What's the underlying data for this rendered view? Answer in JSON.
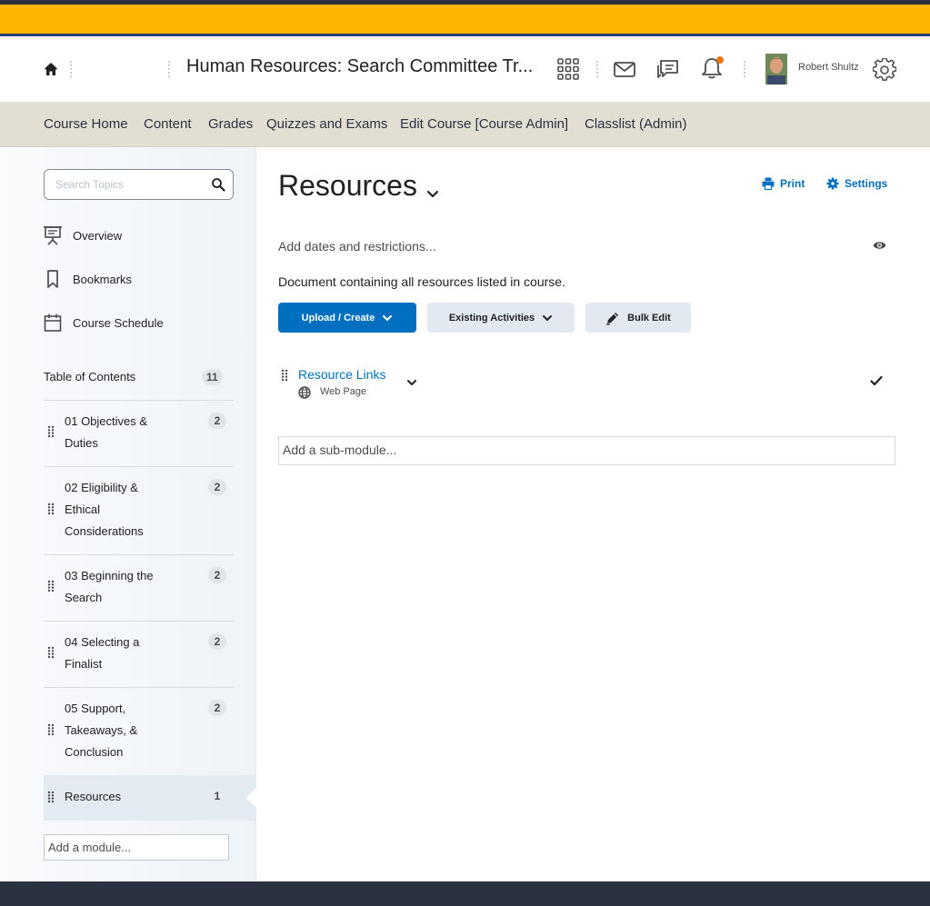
{
  "header": {
    "course_title": "Human Resources: Search Committee Tr...",
    "user_name": "Robert Shultz",
    "notification_color": "#e87511",
    "brand_gold": "#ffb500",
    "brand_blue": "#1c3c76"
  },
  "course_nav": {
    "items": [
      "Course Home",
      "Content",
      "Grades",
      "Quizzes and Exams",
      "Edit Course [Course Admin]",
      "Classlist (Admin)"
    ]
  },
  "sidebar": {
    "search_placeholder": "Search Topics",
    "links": [
      {
        "label": "Overview",
        "icon": "presentation-icon"
      },
      {
        "label": "Bookmarks",
        "icon": "bookmark-icon"
      },
      {
        "label": "Course Schedule",
        "icon": "calendar-icon"
      }
    ],
    "toc": {
      "label": "Table of Contents",
      "count": "11"
    },
    "modules": [
      {
        "label": "01 Objectives & Duties",
        "count": "2"
      },
      {
        "label": "02 Eligibility & Ethical Considerations",
        "count": "2"
      },
      {
        "label": "03 Beginning the Search",
        "count": "2"
      },
      {
        "label": "04 Selecting a Finalist",
        "count": "2"
      },
      {
        "label": "05 Support, Takeaways, & Conclusion",
        "count": "2"
      },
      {
        "label": "Resources",
        "count": "1",
        "active": true
      }
    ],
    "add_module": "Add a module..."
  },
  "main": {
    "title": "Resources",
    "print_label": "Print",
    "settings_label": "Settings",
    "restrictions": "Add dates and restrictions...",
    "description": "Document containing all resources listed in course.",
    "buttons": {
      "upload": "Upload / Create",
      "existing": "Existing Activities",
      "bulk_edit": "Bulk Edit"
    },
    "topic": {
      "title": "Resource Links",
      "type": "Web Page"
    },
    "add_sub_module": "Add a sub-module..."
  }
}
